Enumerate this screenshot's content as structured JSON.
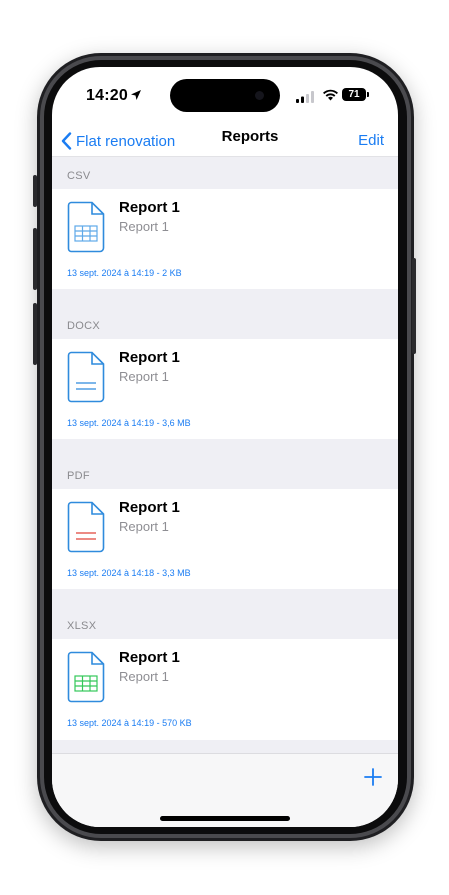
{
  "status_bar": {
    "time": "14:20",
    "battery": "71"
  },
  "nav": {
    "back_label": "Flat renovation",
    "title": "Reports",
    "edit_label": "Edit"
  },
  "sections": [
    {
      "header": "CSV",
      "item": {
        "title": "Report 1",
        "subtitle": "Report 1",
        "meta": "13 sept. 2024 à 14:19 - 2 KB",
        "icon": "csv-file-icon",
        "accent": "#2f8bdd"
      }
    },
    {
      "header": "DOCX",
      "item": {
        "title": "Report 1",
        "subtitle": "Report 1",
        "meta": "13 sept. 2024 à 14:19 - 3,6 MB",
        "icon": "docx-file-icon",
        "accent": "#2f8bdd"
      }
    },
    {
      "header": "PDF",
      "item": {
        "title": "Report 1",
        "subtitle": "Report 1",
        "meta": "13 sept. 2024 à 14:18 - 3,3 MB",
        "icon": "pdf-file-icon",
        "accent": "#e0443a"
      }
    },
    {
      "header": "XLSX",
      "item": {
        "title": "Report 1",
        "subtitle": "Report 1",
        "meta": "13 sept. 2024 à 14:19 - 570 KB",
        "icon": "xlsx-file-icon",
        "accent": "#34c759"
      }
    }
  ],
  "toolbar": {
    "add_icon": "plus-icon",
    "add_label": "+"
  },
  "colors": {
    "tint": "#1a7cf2",
    "section_bg": "#efeff4",
    "icon_outline": "#2f8bdd"
  }
}
